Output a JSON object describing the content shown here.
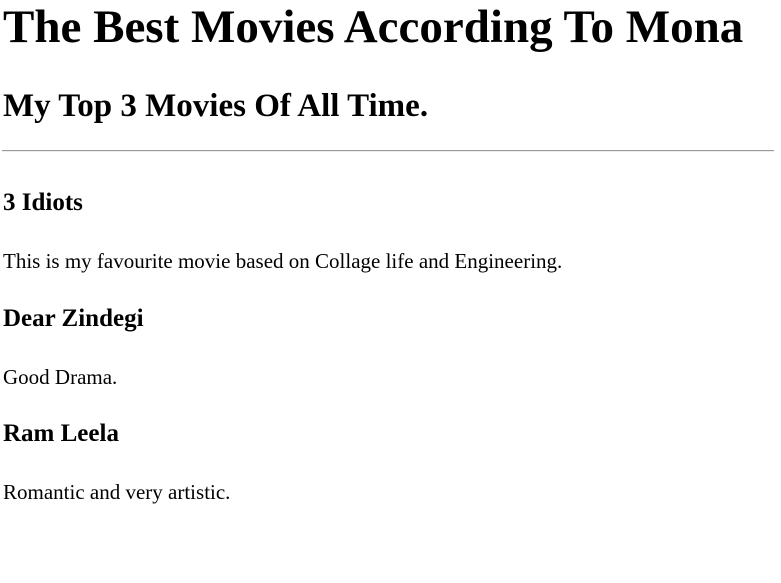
{
  "page": {
    "title": "The Best Movies According To Mona",
    "subtitle": "My Top 3 Movies Of All Time."
  },
  "movies": [
    {
      "title": "3 Idiots",
      "description": "This is my favourite movie based on Collage life and Engineering."
    },
    {
      "title": "Dear Zindegi",
      "description": "Good Drama."
    },
    {
      "title": "Ram Leela",
      "description": "Romantic and very artistic."
    }
  ]
}
